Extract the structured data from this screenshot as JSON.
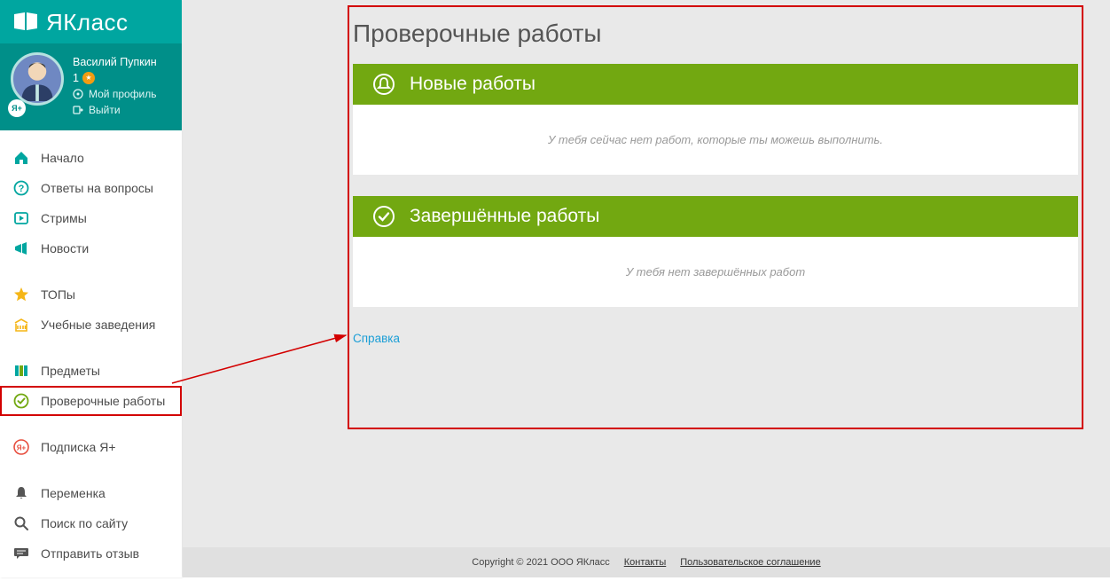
{
  "brand": {
    "name": "ЯКласс"
  },
  "user": {
    "name": "Василий Пупкин",
    "score": "1",
    "badge_text": "Я+",
    "profile_link": "Мой профиль",
    "logout": "Выйти"
  },
  "nav": {
    "items": [
      {
        "key": "home",
        "label": "Начало"
      },
      {
        "key": "answers",
        "label": "Ответы на вопросы"
      },
      {
        "key": "streams",
        "label": "Стримы"
      },
      {
        "key": "news",
        "label": "Новости"
      },
      {
        "key": "tops",
        "label": "ТОПы"
      },
      {
        "key": "schools",
        "label": "Учебные заведения"
      },
      {
        "key": "subjects",
        "label": "Предметы"
      },
      {
        "key": "tests",
        "label": "Проверочные работы"
      },
      {
        "key": "yaplus",
        "label": "Подписка Я+"
      },
      {
        "key": "break",
        "label": "Переменка"
      },
      {
        "key": "search",
        "label": "Поиск по сайту"
      },
      {
        "key": "feedback",
        "label": "Отправить отзыв"
      }
    ]
  },
  "page": {
    "title": "Проверочные работы",
    "panels": {
      "new": {
        "title": "Новые работы",
        "empty": "У тебя сейчас нет работ, которые ты можешь выполнить."
      },
      "done": {
        "title": "Завершённые работы",
        "empty": "У тебя нет завершённых работ"
      }
    },
    "help_link": "Справка"
  },
  "footer": {
    "copyright": "Copyright © 2021 ООО ЯКласс",
    "links": {
      "contacts": "Контакты",
      "terms": "Пользовательское соглашение"
    }
  },
  "colors": {
    "brand_teal": "#00a6a0",
    "brand_teal_dark": "#008f89",
    "accent_green": "#72a811",
    "highlight_red": "#d30000"
  }
}
